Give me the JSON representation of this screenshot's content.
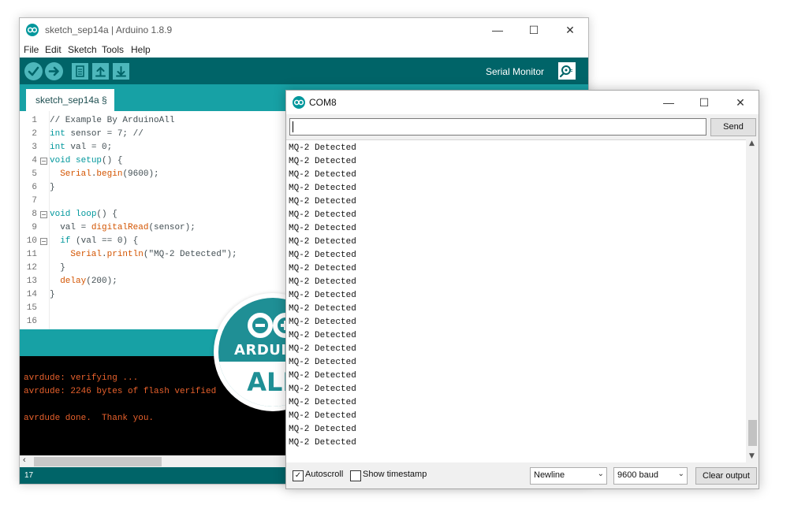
{
  "colors": {
    "arduino_teal": "#00979c",
    "toolbar_dark": "#006468",
    "tab_strip": "#17a1a5",
    "console_text": "#e8612c"
  },
  "ide": {
    "title": "sketch_sep14a | Arduino 1.8.9",
    "window_controls": {
      "minimize": "—",
      "maximize": "☐",
      "close": "✕"
    },
    "menu": [
      "File",
      "Edit",
      "Sketch",
      "Tools",
      "Help"
    ],
    "toolbar": {
      "icons": [
        "verify-icon",
        "upload-icon",
        "new-icon",
        "open-icon",
        "save-icon"
      ],
      "serial_monitor_label": "Serial Monitor"
    },
    "tab": {
      "label": "sketch_sep14a §"
    },
    "code_lines": [
      {
        "n": "1",
        "text": "// Example By ArduinoAll"
      },
      {
        "n": "2",
        "text": "int sensor = 7; //"
      },
      {
        "n": "3",
        "text": "int val = 0;"
      },
      {
        "n": "4",
        "text": "void setup() {"
      },
      {
        "n": "5",
        "text": "  Serial.begin(9600);"
      },
      {
        "n": "6",
        "text": "}"
      },
      {
        "n": "7",
        "text": ""
      },
      {
        "n": "8",
        "text": "void loop() {"
      },
      {
        "n": "9",
        "text": "  val = digitalRead(sensor);"
      },
      {
        "n": "10",
        "text": "  if (val == 0) {"
      },
      {
        "n": "11",
        "text": "    Serial.println(\"MQ-2 Detected\");"
      },
      {
        "n": "12",
        "text": "  }"
      },
      {
        "n": "13",
        "text": "  delay(200);"
      },
      {
        "n": "14",
        "text": "}"
      },
      {
        "n": "15",
        "text": ""
      },
      {
        "n": "16",
        "text": ""
      }
    ],
    "console_lines": [
      "avrdude: verifying ...",
      "avrdude: 2246 bytes of flash verified",
      "",
      "avrdude done.  Thank you."
    ],
    "status_line": "17"
  },
  "serial": {
    "title": "COM8",
    "window_controls": {
      "minimize": "—",
      "maximize": "☐",
      "close": "✕"
    },
    "input_value": "",
    "send_label": "Send",
    "output_lines": [
      "MQ-2 Detected",
      "MQ-2 Detected",
      "MQ-2 Detected",
      "MQ-2 Detected",
      "MQ-2 Detected",
      "MQ-2 Detected",
      "MQ-2 Detected",
      "MQ-2 Detected",
      "MQ-2 Detected",
      "MQ-2 Detected",
      "MQ-2 Detected",
      "MQ-2 Detected",
      "MQ-2 Detected",
      "MQ-2 Detected",
      "MQ-2 Detected",
      "MQ-2 Detected",
      "MQ-2 Detected",
      "MQ-2 Detected",
      "MQ-2 Detected",
      "MQ-2 Detected",
      "MQ-2 Detected",
      "MQ-2 Detected",
      "MQ-2 Detected"
    ],
    "autoscroll": {
      "label": "Autoscroll",
      "checked": true
    },
    "timestamp": {
      "label": "Show timestamp",
      "checked": false
    },
    "line_ending": "Newline",
    "baud": "9600 baud",
    "clear_label": "Clear output"
  },
  "logo": {
    "line1": "ARDUINO",
    "line2": "ALL"
  }
}
